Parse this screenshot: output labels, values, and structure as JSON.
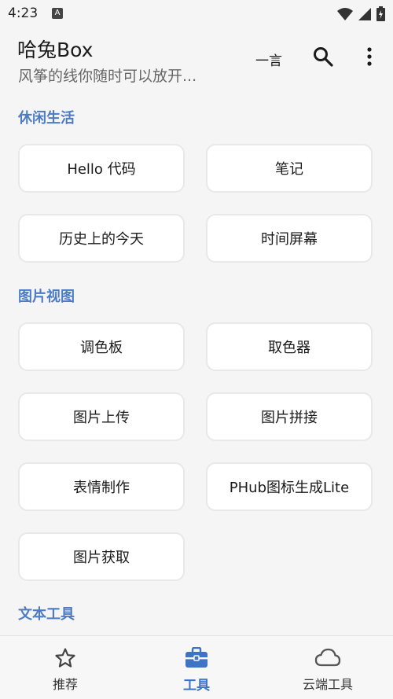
{
  "status_bar": {
    "time": "4:23",
    "notification_icon": "a-icon",
    "icons": [
      "wifi-icon",
      "signal-icon",
      "battery-icon"
    ]
  },
  "header": {
    "title": "哈兔Box",
    "subtitle": "风筝的线你随时可以放开...",
    "yiyan_label": "一言",
    "search_icon": "search-icon",
    "more_icon": "more-vertical-icon"
  },
  "sections": [
    {
      "title": "休闲生活",
      "items": [
        "Hello 代码",
        "笔记",
        "历史上的今天",
        "时间屏幕"
      ]
    },
    {
      "title": "图片视图",
      "items": [
        "调色板",
        "取色器",
        "图片上传",
        "图片拼接",
        "表情制作",
        "PHub图标生成Lite",
        "图片获取"
      ]
    },
    {
      "title": "文本工具",
      "items": []
    }
  ],
  "bottom_nav": {
    "items": [
      {
        "label": "推荐",
        "icon": "star-icon",
        "active": false
      },
      {
        "label": "工具",
        "icon": "toolbox-icon",
        "active": true
      },
      {
        "label": "云端工具",
        "icon": "cloud-icon",
        "active": false
      }
    ]
  },
  "colors": {
    "accent": "#3f73c6",
    "section_title": "#4d7bc4",
    "background": "#f5f5f5",
    "card_border": "#e8e8e8"
  }
}
